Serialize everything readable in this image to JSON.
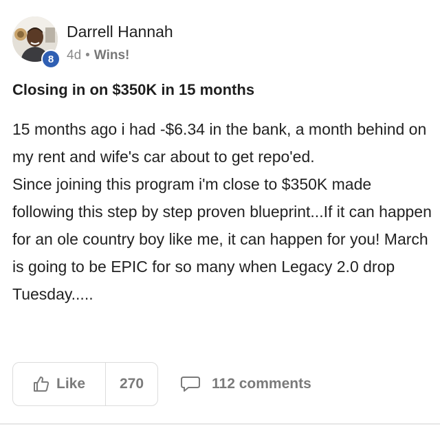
{
  "post": {
    "author": {
      "name": "Darrell Hannah",
      "level": "8",
      "avatar_icon": "user-avatar-photo"
    },
    "meta": {
      "time": "4d",
      "separator": "•",
      "category": "Wins!"
    },
    "title": "Closing in on $350K in 15 months",
    "body": [
      "15 months ago i had -$6.34 in the bank, a month behind on my rent and wife's car about to get repo'ed.",
      "Since joining this program i'm close to $350K made following this step by step proven blueprint...If it can happen for an ole country boy like me, it can happen for you! March is going to be EPIC for so many when Legacy 2.0 drop Tuesday....."
    ],
    "actions": {
      "like_label": "Like",
      "like_count": "270",
      "comments_label": "112 comments",
      "like_icon": "thumbs-up-icon",
      "comment_icon": "comment-bubble-icon"
    }
  },
  "colors": {
    "badge": "#2f5fb3",
    "muted": "#7a7a7a",
    "text": "#222222"
  }
}
